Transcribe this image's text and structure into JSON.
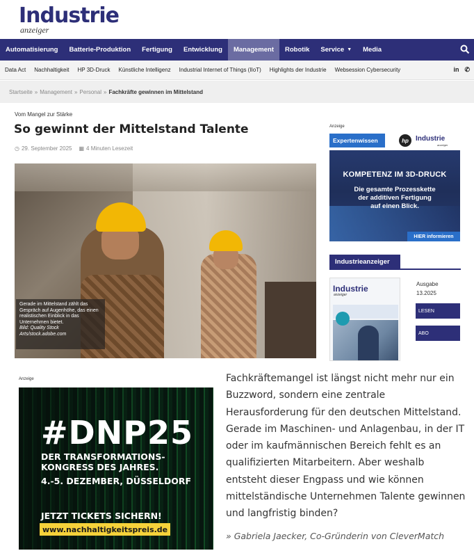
{
  "logo": {
    "main": "Industrie",
    "sub": "anzeiger"
  },
  "mainnav": {
    "items": [
      {
        "label": "Automatisierung"
      },
      {
        "label": "Batterie-Produktion"
      },
      {
        "label": "Fertigung"
      },
      {
        "label": "Entwicklung"
      },
      {
        "label": "Management",
        "active": true
      },
      {
        "label": "Robotik"
      },
      {
        "label": "Service"
      },
      {
        "label": "Media"
      }
    ],
    "search_icon": "search-icon"
  },
  "subnav": {
    "items": [
      "Data Act",
      "Nachhaltigkeit",
      "HP 3D-Druck",
      "Künstliche Intelligenz",
      "Industrial Internet of Things (IIoT)",
      "Highlights der Industrie",
      "Websession Cybersecurity"
    ],
    "linkedin": "in",
    "phone_icon": "phone-icon"
  },
  "breadcrumb": {
    "items": [
      "Startseite",
      "Management",
      "Personal"
    ],
    "separator": "»",
    "current": "Fachkräfte gewinnen im Mittelstand"
  },
  "article": {
    "kicker": "Vom Mangel zur Stärke",
    "title": "So gewinnt der Mittelstand Talente",
    "date": "29. September 2025",
    "reading_time": "4 Minuten Lesezeit",
    "image_caption": "Gerade im Mittelstand zählt das Gespräch auf Augenhöhe, das einen realistischen Einblick in das Unternehmen bietet.",
    "image_credit": "Bild: Quality Stock Arts/stock.adobe.com",
    "body": "Fachkräftemangel ist längst nicht mehr nur ein Buzzword, sondern eine zentrale Herausforderung für den deutschen Mittelstand. Gerade im Maschinen- und Anlagenbau, in der IT oder im kaufmännischen Bereich fehlt es an qualifizierten Mitarbeitern. Aber weshalb entsteht dieser Engpass und wie können mittelständische Unternehmen Talente gewinnen und langfristig binden?",
    "quote": "» Gabriela Jaecker, Co-Gründerin von CleverMatch"
  },
  "sidebar": {
    "ad_label": "Anzeige",
    "ad1": {
      "badge": "Expertenwissen",
      "hp": "hp",
      "brand": "Industrie",
      "brand_sub": "anzeiger",
      "headline": "KOMPETENZ IM 3D-DRUCK",
      "sub1": "Die gesamte Prozesskette",
      "sub2": "der additiven Fertigung",
      "sub3": "auf einen Blick.",
      "cta": "HIER informieren"
    },
    "magazine": {
      "title": "Industrieanzeiger",
      "cover_title": "Industrie",
      "cover_sub": "anzeiger",
      "issue_label": "Ausgabe",
      "issue_number": "13.2025",
      "read_button": "LESEN",
      "subscribe_button": "ABO"
    }
  },
  "ad2": {
    "label": "Anzeige",
    "hashtag": "#DNP25",
    "line1": "DER TRANSFORMATIONS-",
    "line2": "KONGRESS DES JAHRES.",
    "line3": "4.-5. DEZEMBER, DÜSSELDORF",
    "line4": "JETZT TICKETS SICHERN!",
    "url": "www.nachhaltigkeitspreis.de"
  }
}
